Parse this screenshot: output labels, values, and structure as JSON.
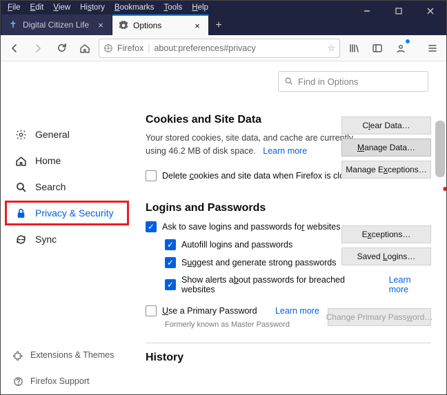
{
  "menubar": [
    "File",
    "Edit",
    "View",
    "History",
    "Bookmarks",
    "Tools",
    "Help"
  ],
  "tabs": [
    {
      "label": "Digital Citizen Life in a digital w",
      "active": false
    },
    {
      "label": "Options",
      "active": true
    }
  ],
  "url": {
    "identity": "Firefox",
    "address": "about:preferences#privacy"
  },
  "search_placeholder": "Find in Options",
  "sidebar": [
    {
      "label": "General",
      "icon": "gear"
    },
    {
      "label": "Home",
      "icon": "home"
    },
    {
      "label": "Search",
      "icon": "search"
    },
    {
      "label": "Privacy & Security",
      "icon": "lock",
      "active": true
    },
    {
      "label": "Sync",
      "icon": "sync"
    }
  ],
  "sidebar_bottom": [
    {
      "label": "Extensions & Themes",
      "icon": "puzzle"
    },
    {
      "label": "Firefox Support",
      "icon": "help"
    }
  ],
  "cookies": {
    "heading": "Cookies and Site Data",
    "desc_prefix": "Your stored cookies, site data, and cache are currently using ",
    "size": "46.2 MB",
    "desc_suffix": " of disk space.",
    "learn_more": "Learn more",
    "buttons": {
      "clear": "Clear Data…",
      "manage": "Manage Data…",
      "exceptions": "Manage Exceptions…"
    },
    "delete_on_close": "Delete cookies and site data when Firefox is closed"
  },
  "logins": {
    "heading": "Logins and Passwords",
    "ask": "Ask to save logins and passwords for websites",
    "autofill": "Autofill logins and passwords",
    "suggest": "Suggest and generate strong passwords",
    "alerts": "Show alerts about passwords for breached websites",
    "primary": "Use a Primary Password",
    "learn_more": "Learn more",
    "note": "Formerly known as Master Password",
    "buttons": {
      "exceptions": "Exceptions…",
      "saved": "Saved Logins…",
      "change": "Change Primary Password…"
    }
  },
  "history_heading": "History"
}
